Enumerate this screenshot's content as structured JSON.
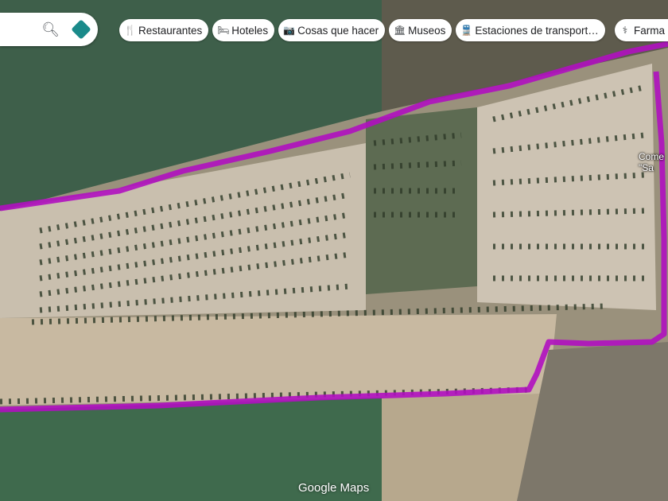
{
  "search": {
    "search_icon": "search-icon",
    "directions_icon": "directions-icon"
  },
  "chips": [
    {
      "icon": "fork-knife-icon",
      "glyph": "🍴",
      "label": "Restaurantes"
    },
    {
      "icon": "bed-icon",
      "glyph": "🛏",
      "label": "Hoteles"
    },
    {
      "icon": "camera-icon",
      "glyph": "📷",
      "label": "Cosas que hacer"
    },
    {
      "icon": "museum-icon",
      "glyph": "🏛",
      "label": "Museos"
    },
    {
      "icon": "transit-icon",
      "glyph": "🚆",
      "label": "Estaciones de transport…"
    },
    {
      "icon": "pharmacy-icon",
      "glyph": "⚕",
      "label": "Farma"
    }
  ],
  "poi": {
    "line1": "Come",
    "line2": "\"Sa"
  },
  "logo": "Google Maps",
  "colors": {
    "route": "#b010c0",
    "directions": "#1a8a8a"
  }
}
